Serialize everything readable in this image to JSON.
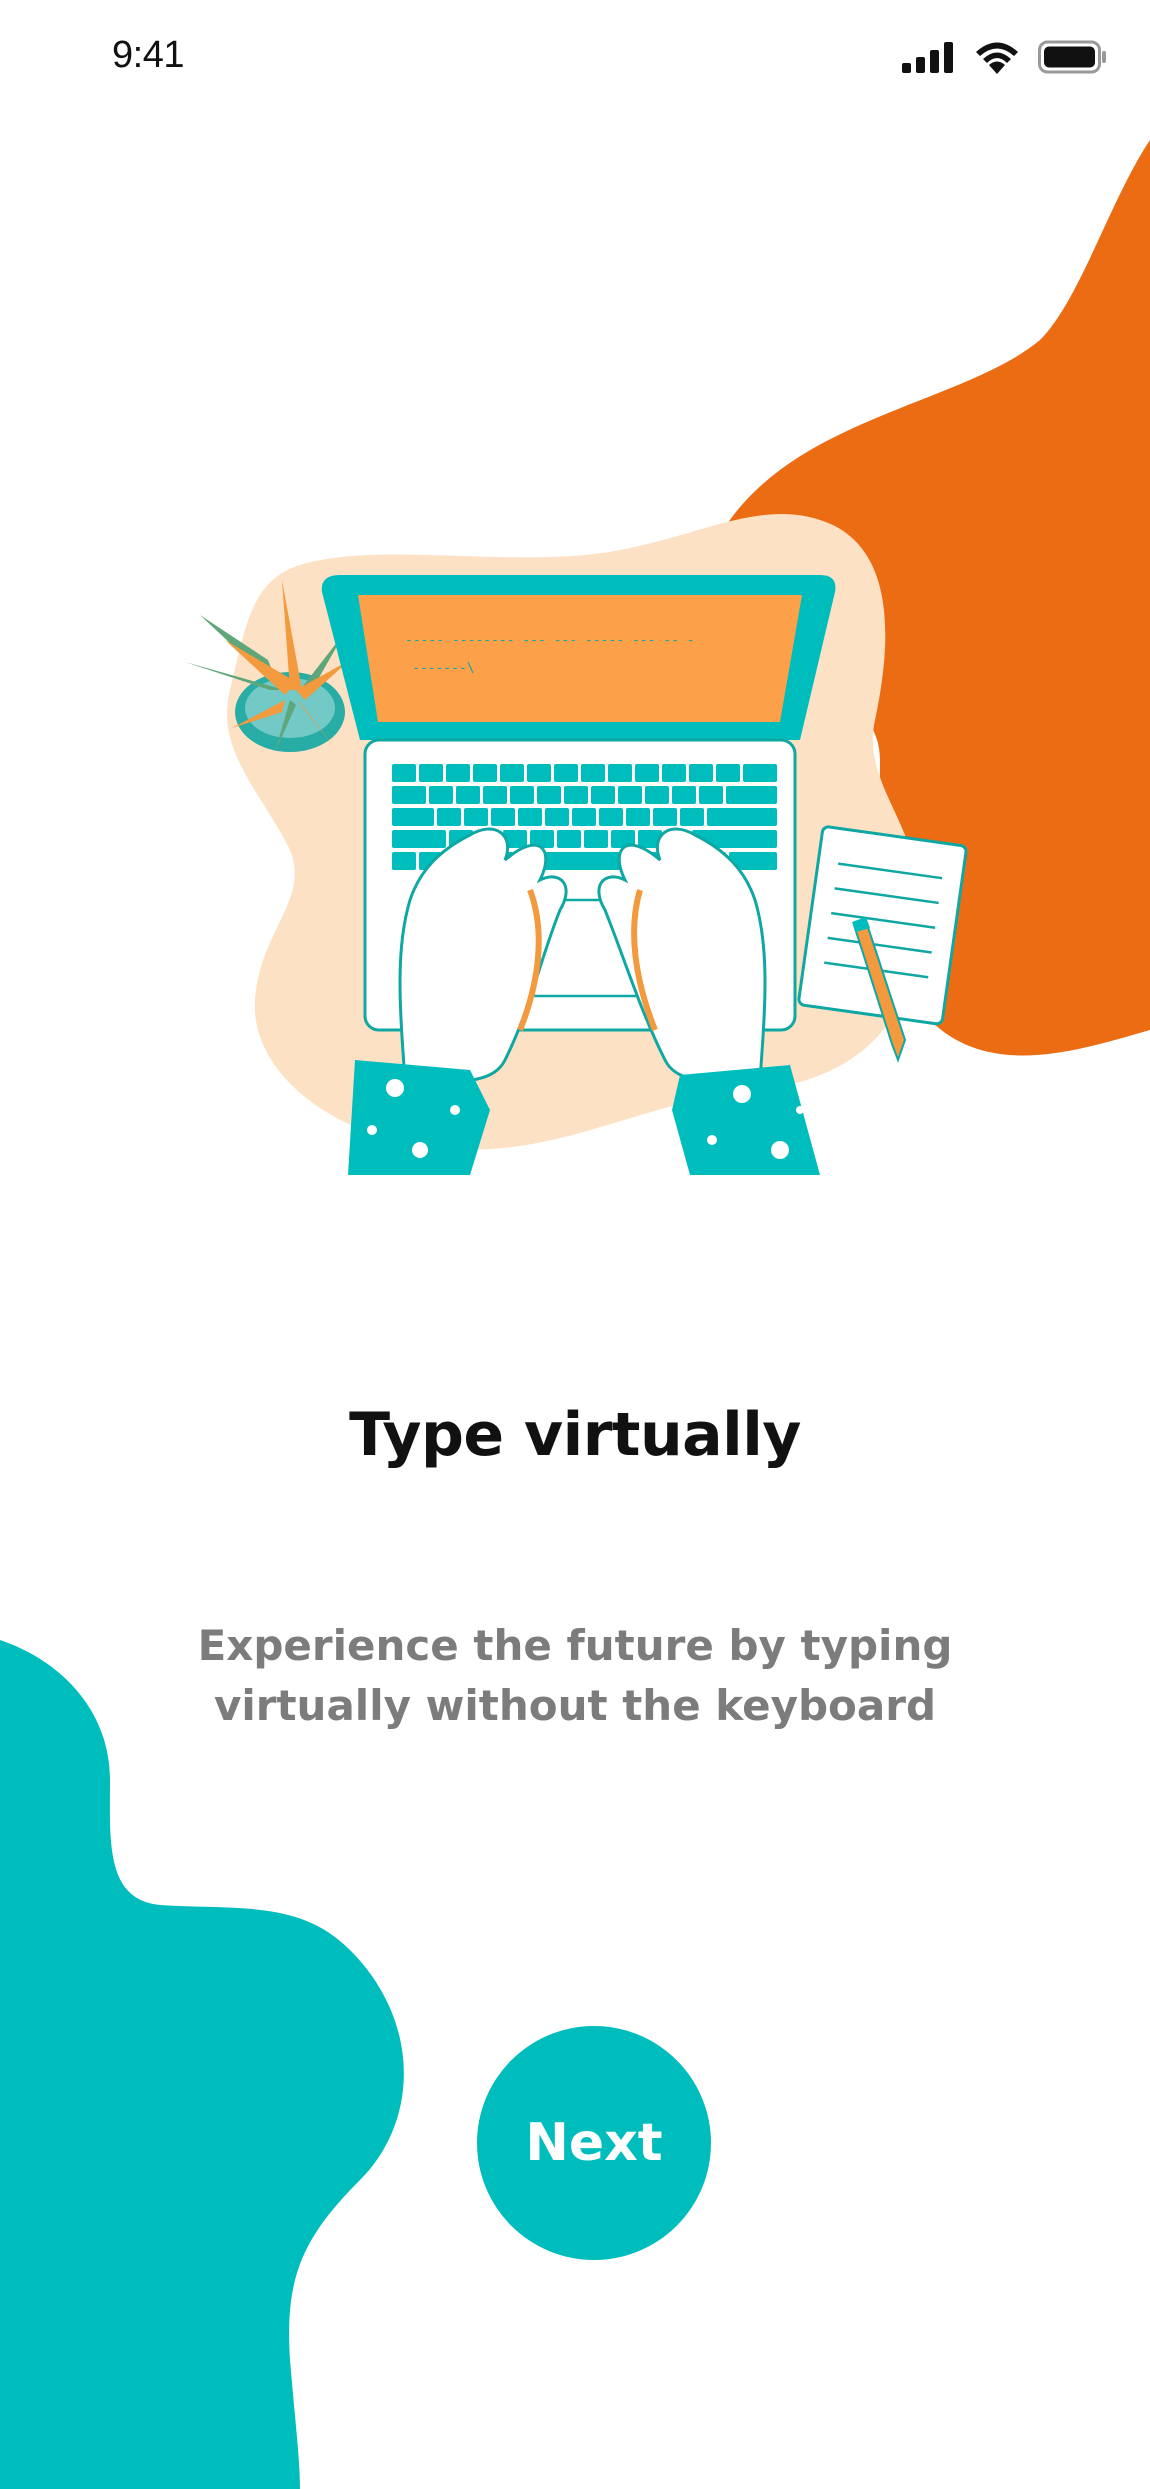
{
  "status_bar": {
    "time": "9:41",
    "icons": [
      "cellular-signal-icon",
      "wifi-icon",
      "battery-icon"
    ]
  },
  "onboarding": {
    "title": "Type virtually",
    "description_line1": "Experience the future by typing",
    "description_line2": "virtually without the keyboard",
    "next_label": "Next"
  },
  "illustration": {
    "subject": "laptop-typing-illustration",
    "screen_text_line1": "----- -------- --- ---    ----- --- -- -",
    "screen_text_line2": "-------\\"
  },
  "colors": {
    "accent_teal": "#00BDBD",
    "accent_orange": "#EC6C14",
    "screen_orange": "#FDA04A",
    "peach": "#FDE1C4",
    "title": "#111111",
    "subtitle": "#7C7C7C",
    "background": "#FFFFFF"
  }
}
